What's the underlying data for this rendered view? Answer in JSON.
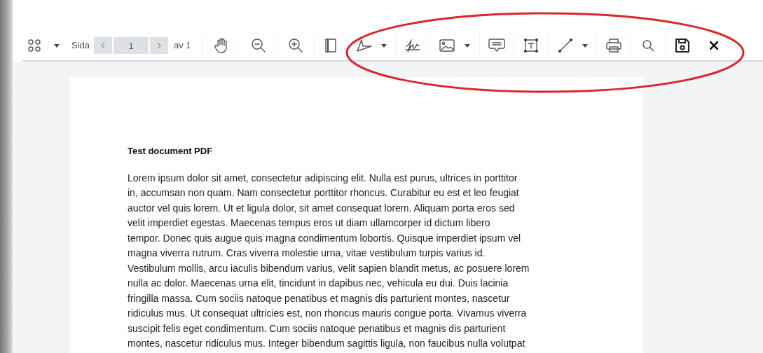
{
  "toolbar": {
    "page_label": "Sida",
    "page_input": {
      "value": "1"
    },
    "page_total": "av 1"
  },
  "document": {
    "title": "Test document PDF",
    "paragraph_lines": [
      "Lorem ipsum dolor sit amet, consectetur adipiscing elit. Nulla est purus, ultrices in porttitor",
      "in, accumsan non quam. Nam consectetur porttitor rhoncus. Curabitur eu est et leo feugiat",
      "auctor vel quis lorem. Ut et ligula dolor, sit amet consequat lorem. Aliquam porta eros sed",
      "velit imperdiet egestas. Maecenas tempus eros ut diam ullamcorper id dictum libero",
      "tempor. Donec quis augue quis magna condimentum lobortis. Quisque imperdiet ipsum vel",
      "magna viverra rutrum. Cras viverra molestie urna, vitae vestibulum turpis varius id.",
      "Vestibulum mollis, arcu iaculis bibendum varius, velit sapien blandit metus, ac posuere lorem",
      "nulla ac dolor. Maecenas urna elit, tincidunt in dapibus nec, vehicula eu dui. Duis lacinia",
      "fringilla massa. Cum sociis natoque penatibus et magnis dis parturient montes, nascetur",
      "ridiculus mus. Ut consequat ultricies est, non rhoncus mauris congue porta. Vivamus viverra",
      "suscipit felis eget condimentum. Cum sociis natoque penatibus et magnis dis parturient",
      "montes, nascetur ridiculus mus. Integer bibendum sagittis ligula, non faucibus nulla volutpat"
    ]
  }
}
